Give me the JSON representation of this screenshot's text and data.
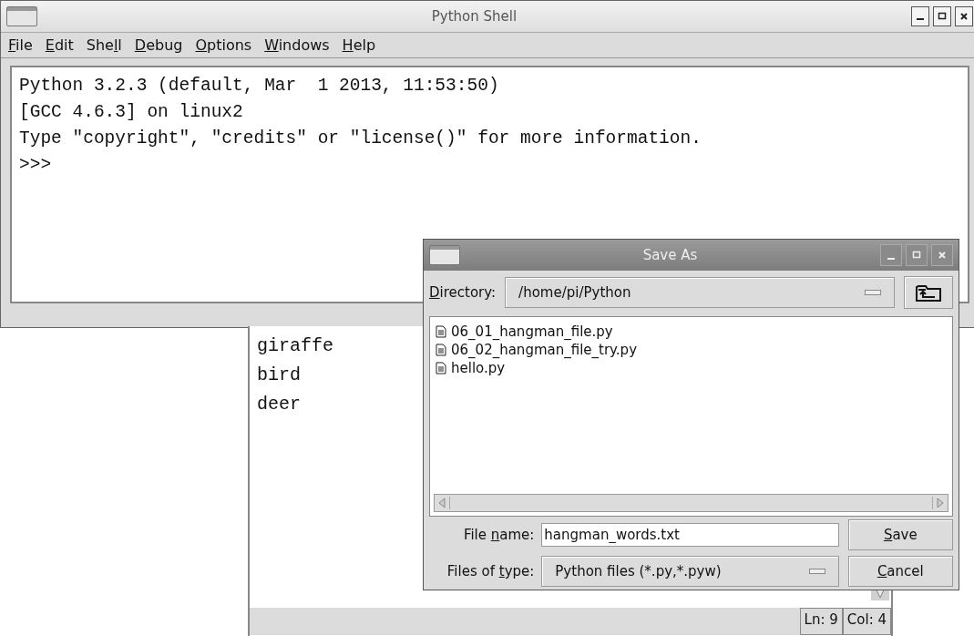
{
  "shell": {
    "title": "Python Shell",
    "menu": [
      "File",
      "Edit",
      "Shell",
      "Debug",
      "Options",
      "Windows",
      "Help"
    ],
    "lines": [
      "Python 3.2.3 (default, Mar  1 2013, 11:53:50)",
      "[GCC 4.6.3] on linux2",
      "Type \"copyright\", \"credits\" or \"license()\" for more information.",
      ">>>"
    ]
  },
  "editor": {
    "lines": [
      "giraffe",
      "bird",
      "deer"
    ],
    "status": [
      {
        "label": "Ln: 9"
      },
      {
        "label": "Col: 4"
      }
    ]
  },
  "dialog": {
    "title": "Save As",
    "directory": {
      "label": "Directory:",
      "value": "/home/pi/Python"
    },
    "files": [
      "06_01_hangman_file.py",
      "06_02_hangman_file_try.py",
      "hello.py"
    ],
    "file_name": {
      "label": "File name:",
      "value": "hangman_words.txt"
    },
    "file_type": {
      "label": "Files of type:",
      "value": "Python files (*.py,*.pyw)"
    },
    "buttons": [
      "Save",
      "Cancel"
    ]
  }
}
